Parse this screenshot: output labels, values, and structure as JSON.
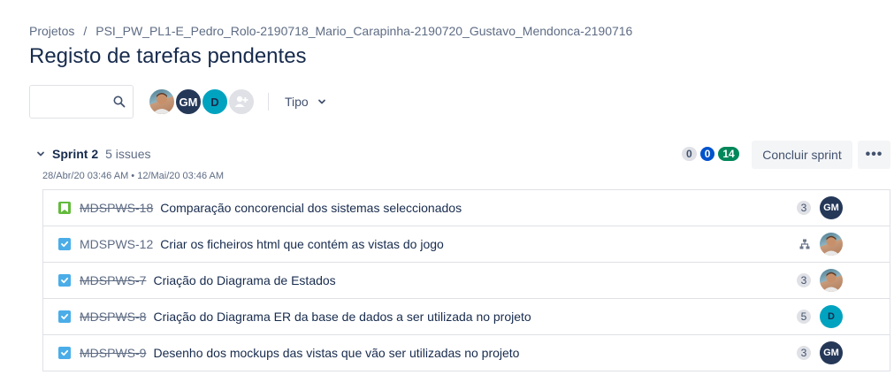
{
  "breadcrumb": {
    "root": "Projetos",
    "separator": "/",
    "project": "PSI_PW_PL1-E_Pedro_Rolo-2190718_Mario_Carapinha-2190720_Gustavo_Mendonca-2190716"
  },
  "page_title": "Registo de tarefas pendentes",
  "search": {
    "value": "",
    "placeholder": ""
  },
  "avatars": [
    {
      "type": "photo",
      "label": ""
    },
    {
      "type": "initials",
      "label": "GM"
    },
    {
      "type": "initials",
      "label": "D"
    },
    {
      "type": "add-people",
      "label": ""
    }
  ],
  "filter": {
    "tipo_label": "Tipo"
  },
  "sprint": {
    "name": "Sprint 2",
    "issue_count": "5 issues",
    "dates": "28/Abr/20 03:46 AM • 12/Mai/20 03:46 AM",
    "counts": {
      "todo": "0",
      "in_progress": "0",
      "done": "14"
    },
    "complete_label": "Concluir sprint",
    "more_label": "•••"
  },
  "issues": [
    {
      "type": "story",
      "key": "MDSPWS-18",
      "done": true,
      "summary": "Comparação concorencial dos sistemas seleccionados",
      "estimate": "3",
      "assignee": "GM",
      "assignee_type": "gm"
    },
    {
      "type": "task",
      "key": "MDSPWS-12",
      "done": false,
      "summary": "Criar os ficheiros html que contém as vistas do jogo",
      "estimate": "",
      "has_subtasks": true,
      "assignee": "",
      "assignee_type": "photo"
    },
    {
      "type": "task",
      "key": "MDSPWS-7",
      "done": true,
      "summary": "Criação do Diagrama de Estados",
      "estimate": "3",
      "assignee": "",
      "assignee_type": "photo"
    },
    {
      "type": "task",
      "key": "MDSPWS-8",
      "done": true,
      "summary": "Criação do Diagrama ER da base de dados a ser utilizada no projeto",
      "estimate": "5",
      "assignee": "D",
      "assignee_type": "d"
    },
    {
      "type": "task",
      "key": "MDSPWS-9",
      "done": true,
      "summary": "Desenho dos mockups das vistas que vão ser utilizadas no projeto",
      "estimate": "3",
      "assignee": "GM",
      "assignee_type": "gm"
    }
  ],
  "colors": {
    "story": "#63ba3c",
    "task": "#4bade8",
    "in_progress": "#0052cc",
    "done": "#00875a"
  }
}
